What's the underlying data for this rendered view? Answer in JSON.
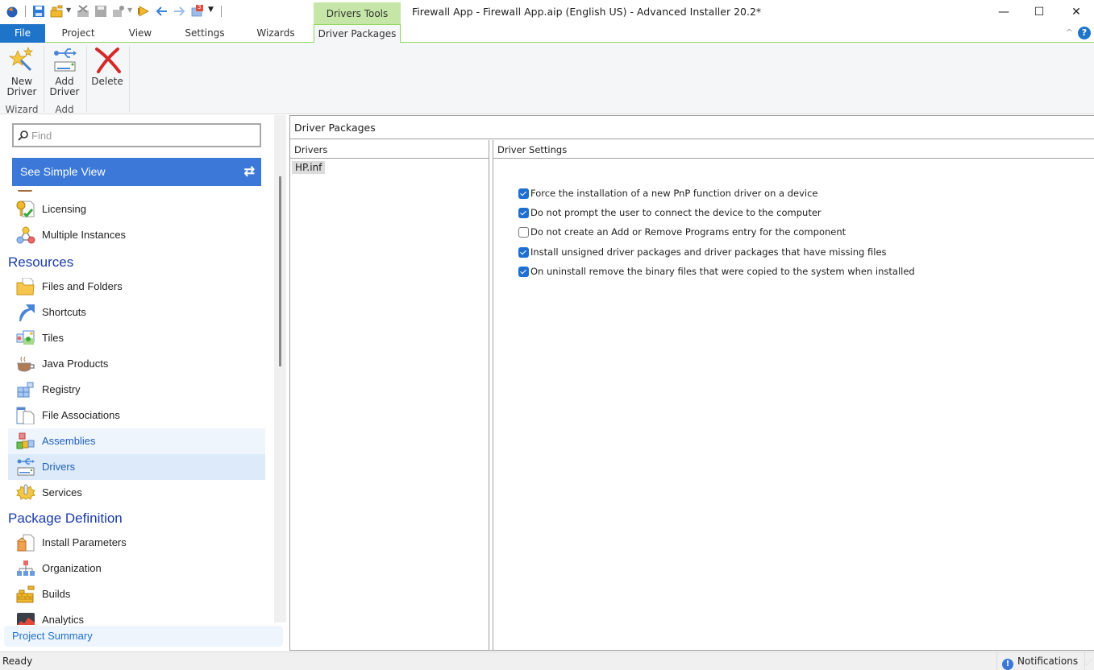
{
  "window": {
    "title": "Firewall App - Firewall App.aip (English US) - Advanced Installer 20.2*",
    "context_tab_header": "Drivers Tools",
    "controls": {
      "minimize": "—",
      "maximize": "☐",
      "close": "✕"
    }
  },
  "quick_access": {
    "icons": [
      "app-logo-icon",
      "save-icon",
      "build-icon",
      "delete-build-icon",
      "save-disabled-icon",
      "configure-icon",
      "run-icon",
      "back-icon",
      "forward-icon",
      "notifications-badge-icon",
      "customize-dropdown-icon"
    ],
    "badge_count": "3"
  },
  "tabs": [
    {
      "label": "File",
      "type": "file"
    },
    {
      "label": "Project"
    },
    {
      "label": "View"
    },
    {
      "label": "Settings"
    },
    {
      "label": "Wizards"
    },
    {
      "label": "Driver Packages",
      "active": true
    }
  ],
  "help_label": "?",
  "collapse_label": "^",
  "ribbon": {
    "groups": [
      {
        "label": "Wizard",
        "buttons": [
          {
            "label_line1": "New",
            "label_line2": "Driver",
            "icon": "wizard-star-icon"
          }
        ]
      },
      {
        "label": "Add",
        "buttons": [
          {
            "label_line1": "Add",
            "label_line2": "Driver",
            "icon": "usb-driver-icon"
          }
        ]
      },
      {
        "label": "",
        "buttons": [
          {
            "label_line1": "Delete",
            "label_line2": "",
            "icon": "delete-x-icon"
          }
        ]
      }
    ]
  },
  "left_pane": {
    "find_placeholder": "Find",
    "simple_view_label": "See Simple View",
    "simple_view_icon": "⇄",
    "items": [
      {
        "label": "Licensing",
        "icon": "licensing-icon"
      },
      {
        "label": "Multiple Instances",
        "icon": "multiple-instances-icon"
      },
      {
        "section": "Resources"
      },
      {
        "label": "Files and Folders",
        "icon": "files-folders-icon"
      },
      {
        "label": "Shortcuts",
        "icon": "shortcuts-icon"
      },
      {
        "label": "Tiles",
        "icon": "tiles-icon"
      },
      {
        "label": "Java Products",
        "icon": "java-products-icon"
      },
      {
        "label": "Registry",
        "icon": "registry-icon"
      },
      {
        "label": "File Associations",
        "icon": "file-associations-icon"
      },
      {
        "label": "Assemblies",
        "icon": "assemblies-icon",
        "state": "hover"
      },
      {
        "label": "Drivers",
        "icon": "drivers-icon",
        "state": "selected"
      },
      {
        "label": "Services",
        "icon": "services-icon"
      },
      {
        "section": "Package Definition"
      },
      {
        "label": "Install Parameters",
        "icon": "install-parameters-icon"
      },
      {
        "label": "Organization",
        "icon": "organization-icon"
      },
      {
        "label": "Builds",
        "icon": "builds-icon"
      },
      {
        "label": "Analytics",
        "icon": "analytics-icon"
      }
    ],
    "project_summary": "Project Summary"
  },
  "main": {
    "title": "Driver Packages",
    "drivers_header": "Drivers",
    "drivers": [
      "HP.inf"
    ],
    "settings_header": "Driver Settings",
    "options": [
      {
        "label": "Force the installation of a new PnP function driver on a device",
        "checked": true
      },
      {
        "label": "Do not prompt the user to connect the device to the computer",
        "checked": true
      },
      {
        "label": "Do not create an Add or Remove Programs entry for the component",
        "checked": false
      },
      {
        "label": "Install unsigned driver packages and driver packages that have missing files",
        "checked": true
      },
      {
        "label": "On uninstall remove the binary files that were copied to the system when installed",
        "checked": true
      }
    ]
  },
  "statusbar": {
    "status": "Ready",
    "notifications_label": "Notifications",
    "notifications_icon": "!"
  },
  "colors": {
    "accent_blue": "#1e74c8",
    "context_green": "#c5e6a6",
    "simple_view_blue": "#3b78d8",
    "section_heading": "#1a3aa8"
  }
}
